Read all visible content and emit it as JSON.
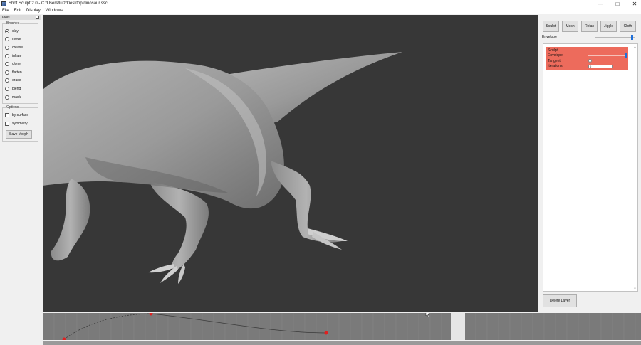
{
  "window": {
    "title": "Shot Sculpt 2.0 - C:/Users/luiz/Desktop/dinosaur.ssc",
    "minimize_glyph": "—",
    "maximize_glyph": "□",
    "close_glyph": "✕"
  },
  "menu": [
    "File",
    "Edit",
    "Display",
    "Windows"
  ],
  "tools": {
    "header": "Tools",
    "brushes_title": "Brushes",
    "brushes": [
      "clay",
      "move",
      "crease",
      "inflate",
      "clone",
      "flatten",
      "erase",
      "blend",
      "mask"
    ],
    "selected_brush": "clay",
    "options_title": "Options",
    "options": [
      {
        "label": "by surface",
        "checked": false
      },
      {
        "label": "symmetry",
        "checked": false
      }
    ],
    "save_morph": "Save Morph"
  },
  "right_panel": {
    "tabs": [
      "Sculpt",
      "Mesh",
      "Relax",
      "Jiggle",
      "Cloth"
    ],
    "envelope_label": "Envelope",
    "envelope_level": 0.95,
    "layer": {
      "name": "Sculpt",
      "envelope_label": "Envelope",
      "envelope_level": 0.95,
      "tangent_label": "Tangent",
      "iterations_label": "Iterations",
      "iterations_value": "0"
    },
    "scroll_up": "▲",
    "scroll_down": "▼",
    "delete_layer": "Delete Layer"
  },
  "colors": {
    "viewport_bg": "#373737",
    "model": "#9a9a9a",
    "layer_card": "#ed6b5c",
    "accent": "#1f6fd8",
    "keyframe": "#e02020",
    "timeline_bg": "#7a7a7a"
  },
  "icons": {
    "app": "app-icon",
    "float": "float-window-icon",
    "cursor": "mouse-cursor-icon"
  }
}
